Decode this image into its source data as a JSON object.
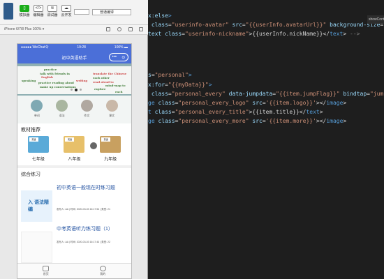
{
  "toolbar": {
    "tools": [
      {
        "label": "模拟器",
        "icon": "phone-icon"
      },
      {
        "label": "编辑器",
        "icon": "code-icon"
      },
      {
        "label": "调试器",
        "icon": "bug-icon"
      },
      {
        "label": "云开发",
        "icon": "cloud-icon"
      }
    ],
    "compile_mode": "普通编译"
  },
  "devbar": {
    "device": "iPhone 6/7/8 Plus 100% ▾"
  },
  "phone": {
    "status_left": "●●●●● WeChat令",
    "status_time": "19:28",
    "status_right": "100% ▬",
    "nav_title": "初中英语助手",
    "capsule": {
      "more": "•••",
      "close": "⊙"
    },
    "banner_phrases": [
      {
        "text": "practice",
        "red": false
      },
      {
        "text": "talk with friends in",
        "red": false
      },
      {
        "text": "English",
        "red": true
      },
      {
        "text": "speaking",
        "red": false
      },
      {
        "text": "practice reading aloud",
        "red": false
      },
      {
        "text": "writing",
        "red": true
      },
      {
        "text": "translate the Chinese",
        "red": true
      },
      {
        "text": "make up conversations",
        "red": false
      },
      {
        "text": "read aloud to",
        "red": true
      },
      {
        "text": "each other",
        "red": false
      },
      {
        "text": "mind-map to",
        "red": false
      },
      {
        "text": "explore",
        "red": false
      },
      {
        "text": "each",
        "red": false
      }
    ],
    "categories": [
      {
        "label": "单词",
        "color": "#7fa9b3"
      },
      {
        "label": "语法",
        "color": "#a9b6a0"
      },
      {
        "label": "作文",
        "color": "#b0a8a0"
      },
      {
        "label": "课文",
        "color": "#c9b8a8"
      }
    ],
    "textbook_title": "教材推荐",
    "books": [
      {
        "name": "七年级",
        "badge": "英语",
        "color": "#5aaad8"
      },
      {
        "name": "八年级",
        "badge": "英语",
        "color": "#e7c06a"
      },
      {
        "name": "九年级",
        "badge": "英语",
        "color": "#c8a060"
      }
    ],
    "practice_title": "综合练习",
    "exercises": [
      {
        "title": "初中英语一般现在时练习题",
        "thumb": "入 语法精编",
        "meta": "发布人: AA | 时间: 2020-03-03 16:17:54 | 类型: 21"
      },
      {
        "title": "中考英语听力练习题（1）",
        "thumb": "",
        "meta": "发布人: AA | 时间: 2020-03-03 16:17:43 | 类型: 22"
      }
    ],
    "tabs": [
      {
        "label": "首页",
        "icon": "home-icon"
      },
      {
        "label": "我的",
        "icon": "user-icon"
      }
    ]
  },
  "editor": {
    "tab_label": "showCont"
  }
}
